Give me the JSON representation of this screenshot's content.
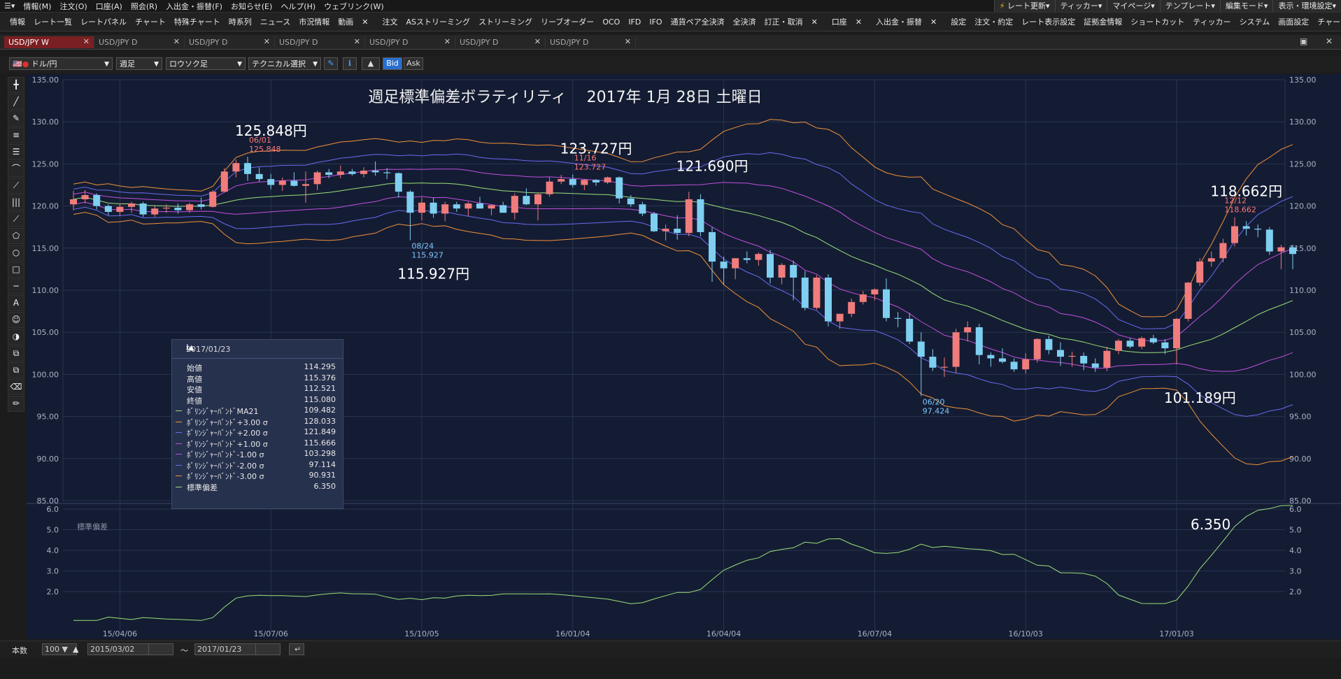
{
  "menu": {
    "items": [
      "情報(M)",
      "注文(O)",
      "口座(A)",
      "照会(R)",
      "入出金・振替(F)",
      "お知らせ(E)",
      "ヘルプ(H)",
      "ウェブリンク(W)"
    ],
    "right_buttons": [
      "レート更新▾",
      "ティッカー▾",
      "マイページ▾",
      "テンプレート▾",
      "編集モード▾",
      "表示・環境設定▾"
    ]
  },
  "toolbar": {
    "group1": [
      "情報",
      "レート一覧",
      "レートパネル",
      "チャート",
      "特殊チャート",
      "時系列",
      "ニュース",
      "市況情報",
      "動画"
    ],
    "group2": [
      "注文",
      "ASストリーミング",
      "ストリーミング",
      "リーブオーダー",
      "OCO",
      "IFD",
      "IFO",
      "通貨ペア全決済",
      "全決済",
      "訂正・取消"
    ],
    "group3": [
      "口座"
    ],
    "group4": [
      "入出金・振替"
    ],
    "group5": [
      "設定",
      "注文・約定",
      "レート表示設定",
      "証拠金情報",
      "ショートカット",
      "ティッカー",
      "システム",
      "画面設定",
      "チャート"
    ]
  },
  "tabs": [
    {
      "label": "USD/JPY W",
      "active": true
    },
    {
      "label": "USD/JPY D",
      "active": false
    },
    {
      "label": "USD/JPY D",
      "active": false
    },
    {
      "label": "USD/JPY D",
      "active": false
    },
    {
      "label": "USD/JPY D",
      "active": false
    },
    {
      "label": "USD/JPY D",
      "active": false
    },
    {
      "label": "USD/JPY D",
      "active": false
    }
  ],
  "controls": {
    "pair": "ドル/円",
    "period": "週足",
    "chart_type": "ロウソク足",
    "technical": "テクニカル選択",
    "bid": "Bid",
    "ask": "Ask"
  },
  "tools": [
    "╋",
    "╱",
    "✎",
    "≡",
    "☰",
    "⌒",
    "⟋",
    "|||",
    "⟋",
    "⬠",
    "○",
    "□",
    "─",
    "A",
    "☺",
    "◑",
    "⧉",
    "⧉",
    "⌫",
    "✏"
  ],
  "footer": {
    "count_label": "本数",
    "count": "100",
    "from": "2015/03/02",
    "tilde": "～",
    "to": "2017/01/23"
  },
  "chart_data": {
    "type": "candlestick",
    "title": "週足標準偏差ボラティリティ　 2017年 1月 28日 土曜日",
    "y_ticks": [
      "135.00",
      "130.00",
      "125.00",
      "120.00",
      "115.00",
      "110.00",
      "105.00",
      "100.00",
      "95.00",
      "90.00",
      "85.00"
    ],
    "x_ticks": [
      "15/04/06",
      "15/07/06",
      "15/10/05",
      "16/01/04",
      "16/04/04",
      "16/07/04",
      "16/10/03",
      "17/01/03"
    ],
    "sub_panel_label": "標準偏差",
    "sub_y_ticks": [
      "6.0",
      "5.0",
      "4.0",
      "3.0",
      "2.0"
    ],
    "sub_last_value": "6.350",
    "annotations": [
      {
        "big": "125.848円",
        "date": "06/01",
        "value": "125.848",
        "color": "#ff7878"
      },
      {
        "big": "123.727円",
        "date": "11/16",
        "value": "123.727",
        "color": "#ff7878"
      },
      {
        "big": "121.690円"
      },
      {
        "big": "118.662円",
        "date": "12/12",
        "value": "118.662",
        "color": "#ff7878"
      },
      {
        "big": "115.927円",
        "date": "08/24",
        "value": "115.927",
        "color": "#7ec8ff"
      },
      {
        "big": "101.189円"
      },
      {
        "date": "06/20",
        "value": "97.424",
        "color": "#7ec8ff"
      }
    ],
    "candles": [
      [
        120.2,
        121.8,
        119.5,
        120.8
      ],
      [
        120.8,
        121.9,
        120.3,
        121.3
      ],
      [
        121.3,
        121.5,
        119.6,
        120.0
      ],
      [
        120.0,
        120.2,
        118.9,
        119.3
      ],
      [
        119.3,
        120.3,
        118.8,
        119.9
      ],
      [
        119.9,
        120.5,
        119.2,
        120.3
      ],
      [
        120.3,
        120.5,
        118.7,
        119.0
      ],
      [
        119.0,
        120.0,
        118.7,
        119.7
      ],
      [
        119.7,
        120.2,
        119.2,
        119.8
      ],
      [
        119.8,
        120.3,
        119.1,
        119.5
      ],
      [
        119.5,
        120.4,
        119.2,
        120.2
      ],
      [
        120.2,
        121.0,
        119.6,
        119.9
      ],
      [
        119.9,
        121.9,
        119.8,
        121.7
      ],
      [
        121.7,
        124.5,
        121.6,
        124.1
      ],
      [
        124.1,
        125.5,
        123.4,
        125.1
      ],
      [
        125.1,
        125.85,
        123.0,
        123.8
      ],
      [
        123.8,
        124.6,
        122.9,
        123.2
      ],
      [
        123.2,
        123.8,
        122.0,
        122.5
      ],
      [
        122.5,
        123.4,
        121.8,
        123.0
      ],
      [
        123.0,
        124.0,
        122.3,
        122.4
      ],
      [
        122.4,
        124.1,
        120.4,
        122.6
      ],
      [
        122.6,
        124.2,
        121.9,
        124.0
      ],
      [
        124.0,
        124.4,
        123.3,
        123.7
      ],
      [
        123.7,
        124.8,
        123.3,
        124.1
      ],
      [
        124.1,
        124.4,
        123.6,
        123.8
      ],
      [
        123.8,
        124.6,
        123.4,
        124.2
      ],
      [
        124.2,
        125.3,
        123.6,
        124.0
      ],
      [
        124.0,
        124.5,
        123.2,
        123.9
      ],
      [
        123.9,
        124.0,
        121.0,
        121.7
      ],
      [
        121.7,
        121.9,
        115.93,
        119.2
      ],
      [
        119.2,
        121.0,
        118.3,
        120.4
      ],
      [
        120.4,
        121.0,
        118.6,
        119.1
      ],
      [
        119.1,
        120.5,
        118.2,
        120.2
      ],
      [
        120.2,
        120.5,
        119.3,
        119.7
      ],
      [
        119.7,
        120.5,
        118.8,
        120.3
      ],
      [
        120.3,
        121.1,
        119.9,
        119.7
      ],
      [
        119.7,
        120.2,
        118.9,
        120.1
      ],
      [
        120.1,
        120.5,
        119.3,
        119.2
      ],
      [
        119.2,
        121.5,
        118.4,
        121.2
      ],
      [
        121.2,
        122.1,
        120.1,
        120.2
      ],
      [
        120.2,
        121.6,
        118.3,
        121.4
      ],
      [
        121.4,
        123.4,
        121.1,
        122.9
      ],
      [
        122.9,
        123.7,
        122.6,
        123.2
      ],
      [
        123.2,
        123.73,
        122.2,
        122.5
      ],
      [
        122.5,
        123.2,
        121.9,
        123.1
      ],
      [
        123.1,
        123.2,
        122.4,
        122.8
      ],
      [
        122.8,
        123.5,
        122.6,
        123.4
      ],
      [
        123.4,
        123.5,
        120.3,
        120.9
      ],
      [
        120.9,
        121.3,
        119.9,
        120.2
      ],
      [
        120.2,
        120.5,
        118.8,
        119.1
      ],
      [
        119.1,
        119.3,
        116.9,
        117.0
      ],
      [
        117.0,
        117.8,
        115.9,
        117.3
      ],
      [
        117.3,
        118.9,
        116.0,
        116.8
      ],
      [
        116.8,
        121.69,
        116.4,
        120.8
      ],
      [
        120.8,
        121.4,
        116.4,
        116.9
      ],
      [
        116.9,
        117.5,
        111.0,
        113.4
      ],
      [
        113.4,
        114.0,
        110.7,
        112.6
      ],
      [
        112.6,
        113.8,
        111.3,
        113.8
      ],
      [
        113.8,
        114.6,
        113.2,
        113.6
      ],
      [
        113.6,
        114.5,
        112.9,
        114.3
      ],
      [
        114.3,
        114.8,
        110.8,
        111.5
      ],
      [
        111.5,
        113.2,
        110.7,
        113.0
      ],
      [
        113.0,
        113.5,
        108.8,
        111.5
      ],
      [
        111.5,
        112.3,
        107.6,
        107.9
      ],
      [
        107.9,
        111.8,
        107.7,
        111.5
      ],
      [
        111.5,
        111.9,
        105.7,
        106.3
      ],
      [
        106.3,
        107.2,
        105.4,
        107.2
      ],
      [
        107.2,
        109.0,
        106.8,
        108.6
      ],
      [
        108.6,
        109.9,
        108.3,
        109.5
      ],
      [
        109.5,
        110.2,
        108.8,
        110.1
      ],
      [
        110.1,
        111.4,
        106.3,
        106.7
      ],
      [
        106.7,
        107.4,
        105.6,
        106.6
      ],
      [
        106.6,
        107.3,
        103.6,
        103.9
      ],
      [
        103.9,
        105.0,
        97.42,
        102.1
      ],
      [
        102.1,
        103.0,
        100.4,
        100.8
      ],
      [
        100.8,
        102.0,
        99.7,
        100.9
      ],
      [
        100.9,
        105.4,
        100.2,
        105.0
      ],
      [
        105.0,
        106.3,
        103.9,
        105.6
      ],
      [
        105.6,
        106.0,
        101.2,
        102.3
      ],
      [
        102.3,
        102.6,
        100.9,
        101.9
      ],
      [
        101.9,
        103.1,
        101.3,
        101.5
      ],
      [
        101.5,
        101.9,
        100.3,
        100.6
      ],
      [
        100.6,
        102.5,
        100.1,
        101.8
      ],
      [
        101.8,
        104.3,
        101.4,
        104.2
      ],
      [
        104.2,
        104.6,
        102.4,
        102.9
      ],
      [
        102.9,
        103.8,
        101.0,
        102.1
      ],
      [
        102.1,
        102.7,
        100.9,
        102.2
      ],
      [
        102.2,
        102.6,
        100.5,
        101.3
      ],
      [
        101.3,
        101.9,
        100.3,
        100.8
      ],
      [
        100.8,
        103.3,
        100.4,
        102.8
      ],
      [
        102.8,
        104.2,
        102.4,
        104.0
      ],
      [
        104.0,
        104.3,
        103.1,
        103.3
      ],
      [
        103.3,
        104.5,
        103.0,
        104.3
      ],
      [
        104.3,
        104.7,
        103.6,
        103.8
      ],
      [
        103.8,
        104.2,
        102.4,
        103.1
      ],
      [
        103.1,
        106.7,
        101.19,
        106.6
      ],
      [
        106.6,
        111.0,
        106.3,
        110.9
      ],
      [
        110.9,
        113.8,
        110.5,
        113.4
      ],
      [
        113.4,
        114.6,
        112.8,
        113.8
      ],
      [
        113.8,
        116.1,
        113.3,
        115.6
      ],
      [
        115.6,
        118.66,
        115.2,
        117.6
      ],
      [
        117.6,
        118.2,
        116.5,
        117.3
      ],
      [
        117.3,
        117.8,
        116.3,
        117.2
      ],
      [
        117.2,
        117.5,
        114.2,
        114.6
      ],
      [
        114.6,
        115.4,
        112.5,
        115.1
      ],
      [
        115.1,
        115.4,
        112.5,
        114.3
      ]
    ],
    "info_box": {
      "date": "2017/01/23",
      "rows": [
        {
          "label": "始値",
          "value": "114.295",
          "color": ""
        },
        {
          "label": "高値",
          "value": "115.376",
          "color": ""
        },
        {
          "label": "安値",
          "value": "112.521",
          "color": ""
        },
        {
          "label": "終値",
          "value": "115.080",
          "color": ""
        },
        {
          "label": "ﾎﾞﾘﾝｼﾞｬｰﾊﾞﾝﾄﾞMA21",
          "value": "109.482",
          "color": "#9be07a"
        },
        {
          "label": "ﾎﾞﾘﾝｼﾞｬｰﾊﾞﾝﾄﾞ+3.00 σ",
          "value": "128.033",
          "color": "#f0923a"
        },
        {
          "label": "ﾎﾞﾘﾝｼﾞｬｰﾊﾞﾝﾄﾞ+2.00 σ",
          "value": "121.849",
          "color": "#6a6af0"
        },
        {
          "label": "ﾎﾞﾘﾝｼﾞｬｰﾊﾞﾝﾄﾞ+1.00 σ",
          "value": "115.666",
          "color": "#c050e0"
        },
        {
          "label": "ﾎﾞﾘﾝｼﾞｬｰﾊﾞﾝﾄﾞ-1.00 σ",
          "value": "103.298",
          "color": "#c050e0"
        },
        {
          "label": "ﾎﾞﾘﾝｼﾞｬｰﾊﾞﾝﾄﾞ-2.00 σ",
          "value": "97.114",
          "color": "#6a6af0"
        },
        {
          "label": "ﾎﾞﾘﾝｼﾞｬｰﾊﾞﾝﾄﾞ-3.00 σ",
          "value": "90.931",
          "color": "#f0923a"
        },
        {
          "label": "標準偏差",
          "value": "6.350",
          "color": "#9be07a"
        }
      ]
    },
    "colors": {
      "up": "#f07c7c",
      "down": "#7ecff0",
      "bg": "#141c33",
      "grid": "#2a3452",
      "ma": "#9be07a",
      "s3": "#f0923a",
      "s2": "#6a6af0",
      "s1": "#c050e0",
      "text": "#aab2c4"
    }
  }
}
